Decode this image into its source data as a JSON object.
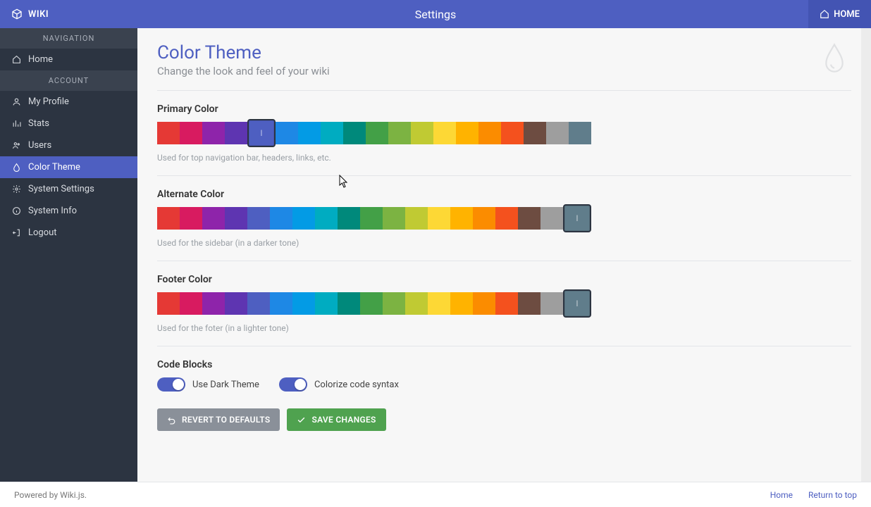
{
  "brand": "WIKI",
  "header_title": "Settings",
  "home_label": "HOME",
  "sidebar": {
    "nav_header": "NAVIGATION",
    "account_header": "ACCOUNT",
    "home": "Home",
    "items": [
      {
        "label": "My Profile"
      },
      {
        "label": "Stats"
      },
      {
        "label": "Users"
      },
      {
        "label": "Color Theme"
      },
      {
        "label": "System Settings"
      },
      {
        "label": "System Info"
      },
      {
        "label": "Logout"
      }
    ]
  },
  "page": {
    "title": "Color Theme",
    "subtitle": "Change the look and feel of your wiki"
  },
  "palette": [
    "#e53935",
    "#d81b60",
    "#8e24aa",
    "#5e35b1",
    "#4e5fc1",
    "#1e88e5",
    "#039be5",
    "#00acc1",
    "#00897b",
    "#43a047",
    "#7cb342",
    "#c0ca33",
    "#fdd835",
    "#ffb300",
    "#fb8c00",
    "#f4511e",
    "#6d4c41",
    "#9e9e9e",
    "#607d8b"
  ],
  "sections": {
    "primary": {
      "label": "Primary Color",
      "help": "Used for top navigation bar, headers, links, etc.",
      "selected_index": 4
    },
    "alternate": {
      "label": "Alternate Color",
      "help": "Used for the sidebar (in a darker tone)",
      "selected_index": 18
    },
    "footer": {
      "label": "Footer Color",
      "help": "Used for the foter (in a lighter tone)",
      "selected_index": 18
    }
  },
  "code_blocks": {
    "label": "Code Blocks",
    "dark_theme_label": "Use Dark Theme",
    "colorize_label": "Colorize code syntax",
    "dark_theme_on": true,
    "colorize_on": true
  },
  "actions": {
    "revert": "REVERT TO DEFAULTS",
    "save": "SAVE CHANGES"
  },
  "footer_bar": {
    "powered": "Powered by Wiki.js.",
    "home": "Home",
    "top": "Return to top"
  }
}
